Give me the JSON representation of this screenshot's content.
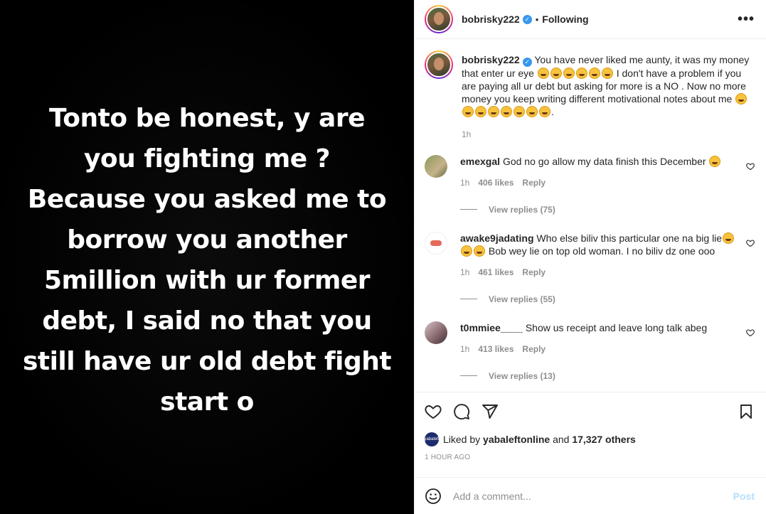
{
  "post_image_text": "Tonto be honest, y are you fighting me ? Because you asked me to borrow you another 5million with ur former debt, I said no that you still have ur old debt fight start o",
  "header": {
    "username": "bobrisky222",
    "separator": "•",
    "follow_status": "Following",
    "more_label": "•••"
  },
  "caption": {
    "username": "bobrisky222",
    "part1": "You have never liked me aunty, it was my money that enter ur eye",
    "part2": "I don't have a problem if you are paying all ur debt but asking for more is a NO . Now no more money you keep writing different motivational notes about me",
    "part3": ".",
    "time": "1h"
  },
  "comments": [
    {
      "username": "emexgal",
      "text": "God no go allow my data finish this December",
      "time": "1h",
      "likes": "406 likes",
      "reply": "Reply",
      "view_replies": "View replies (75)"
    },
    {
      "username": "awake9jadating",
      "text_a": "Who else biliv this particular one na big lie",
      "text_b": "Bob wey lie on top old woman. I no biliv dz one ooo",
      "time": "1h",
      "likes": "461 likes",
      "reply": "Reply",
      "view_replies": "View replies (55)"
    },
    {
      "username": "t0mmiee____",
      "text": "Show us receipt and leave long talk abeg",
      "time": "1h",
      "likes": "413 likes",
      "reply": "Reply",
      "view_replies": "View replies (13)"
    }
  ],
  "likes": {
    "prefix": "Liked by",
    "user": "yabaleftonline",
    "middle": "and",
    "others": "17,327 others",
    "mini_avatar_text": "yabaleft"
  },
  "time_ago": "1 HOUR AGO",
  "add_comment": {
    "placeholder": "Add a comment...",
    "post_label": "Post"
  },
  "colors": {
    "verified": "#3897f0",
    "muted": "#8e8e8e",
    "post_disabled": "#b2dffc"
  }
}
